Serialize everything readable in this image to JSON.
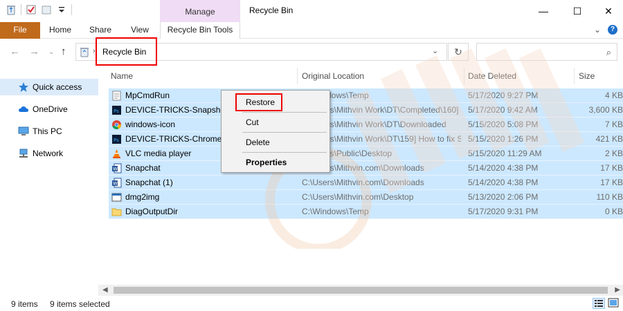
{
  "window": {
    "title": "Recycle Bin",
    "contextual_group": "Manage",
    "minimize_glyph": "—",
    "maximize_glyph": "☐",
    "close_glyph": "✕"
  },
  "ribbon": {
    "tabs": [
      "File",
      "Home",
      "Share",
      "View",
      "Recycle Bin Tools"
    ],
    "expand_glyph": "⌄",
    "help_glyph": "?"
  },
  "address": {
    "path": "Recycle Bin",
    "search_placeholder": ""
  },
  "sidebar": {
    "items": [
      {
        "label": "Quick access",
        "icon": "star-icon"
      },
      {
        "label": "OneDrive",
        "icon": "cloud-icon"
      },
      {
        "label": "This PC",
        "icon": "computer-icon"
      },
      {
        "label": "Network",
        "icon": "network-icon"
      }
    ]
  },
  "columns": [
    "Name",
    "Original Location",
    "Date Deleted",
    "Size"
  ],
  "files": [
    {
      "name": "MpCmdRun",
      "location": "C:\\Windows\\Temp",
      "date": "5/17/2020 9:27 PM",
      "size": "4 KB",
      "icon": "text-file-icon"
    },
    {
      "name": "DEVICE-TRICKS-Snapshots",
      "location": "C:\\Users\\Mithvin Work\\DT\\Completed\\160] Ho...",
      "date": "5/17/2020 9:42 AM",
      "size": "3,600 KB",
      "icon": "photoshop-file-icon"
    },
    {
      "name": "windows-icon",
      "location": "C:\\Users\\Mithvin Work\\DT\\Downloaded",
      "date": "5/15/2020 5:08 PM",
      "size": "7 KB",
      "icon": "chrome-file-icon"
    },
    {
      "name": "DEVICE-TRICKS-Chrome - ...",
      "location": "C:\\Users\\Mithvin Work\\DT\\159] How to fix Sho...",
      "date": "5/15/2020 1:26 PM",
      "size": "421 KB",
      "icon": "photoshop-file-icon"
    },
    {
      "name": "VLC media player",
      "location": "C:\\Users\\Public\\Desktop",
      "date": "5/15/2020 11:29 AM",
      "size": "2 KB",
      "icon": "vlc-icon"
    },
    {
      "name": "Snapchat",
      "location": "C:\\Users\\Mithvin.com\\Downloads",
      "date": "5/14/2020 4:38 PM",
      "size": "17 KB",
      "icon": "word-file-icon"
    },
    {
      "name": "Snapchat (1)",
      "location": "C:\\Users\\Mithvin.com\\Downloads",
      "date": "5/14/2020 4:38 PM",
      "size": "17 KB",
      "icon": "word-file-icon"
    },
    {
      "name": "dmg2img",
      "location": "C:\\Users\\Mithvin.com\\Desktop",
      "date": "5/13/2020 2:06 PM",
      "size": "110 KB",
      "icon": "app-file-icon"
    },
    {
      "name": "DiagOutputDir",
      "location": "C:\\Windows\\Temp",
      "date": "5/17/2020 9:31 PM",
      "size": "0 KB",
      "icon": "folder-icon"
    }
  ],
  "context_menu": {
    "items": [
      "Restore",
      "Cut",
      "Delete",
      "Properties"
    ]
  },
  "status": {
    "count": "9 items",
    "selected": "9 items selected"
  },
  "colors": {
    "file_tab": "#c06a1c",
    "manage_tab": "#f0dcf5",
    "selection": "#cce8ff",
    "highlight_box": "#ee0000"
  }
}
